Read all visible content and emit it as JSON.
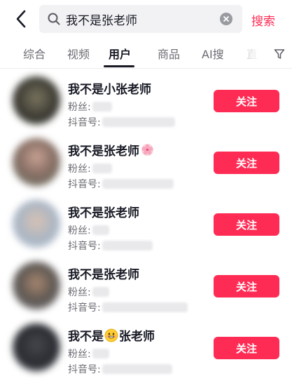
{
  "search": {
    "query": "我不是张老师",
    "submit_label": "搜索"
  },
  "tabs": [
    {
      "label": "综合",
      "active": false
    },
    {
      "label": "视频",
      "active": false
    },
    {
      "label": "用户",
      "active": true
    },
    {
      "label": "商品",
      "active": false
    },
    {
      "label": "AI搜",
      "active": false
    },
    {
      "label": "直",
      "active": false
    }
  ],
  "users": [
    {
      "name": "我不是小张老师",
      "name_emoji": "",
      "name_suffix": "",
      "fans_label": "粉丝:",
      "id_label": "抖音号:",
      "follow_label": "关注"
    },
    {
      "name": "我不是张老师",
      "name_emoji": "cherry-blossom-emoji",
      "name_suffix": "",
      "fans_label": "粉丝:",
      "id_label": "抖音号:",
      "follow_label": "关注"
    },
    {
      "name": "我不是张老师",
      "name_emoji": "",
      "name_suffix": "",
      "fans_label": "粉丝:",
      "id_label": "抖音号:",
      "follow_label": "关注"
    },
    {
      "name": "我不是张老师",
      "name_emoji": "",
      "name_suffix": "",
      "fans_label": "粉丝:",
      "id_label": "抖音号:",
      "follow_label": "关注"
    },
    {
      "name": "我不是",
      "name_emoji": "grinning-face-emoji",
      "name_suffix": "张老师",
      "fans_label": "粉丝:",
      "id_label": "抖音号:",
      "follow_label": "关注"
    }
  ],
  "colors": {
    "accent": "#fe2c55",
    "text_primary": "#161823",
    "text_secondary": "#6b6c73",
    "search_bg": "#f2f2f4"
  },
  "icons": [
    "back-arrow-icon",
    "search-icon",
    "clear-icon",
    "filter-icon"
  ]
}
